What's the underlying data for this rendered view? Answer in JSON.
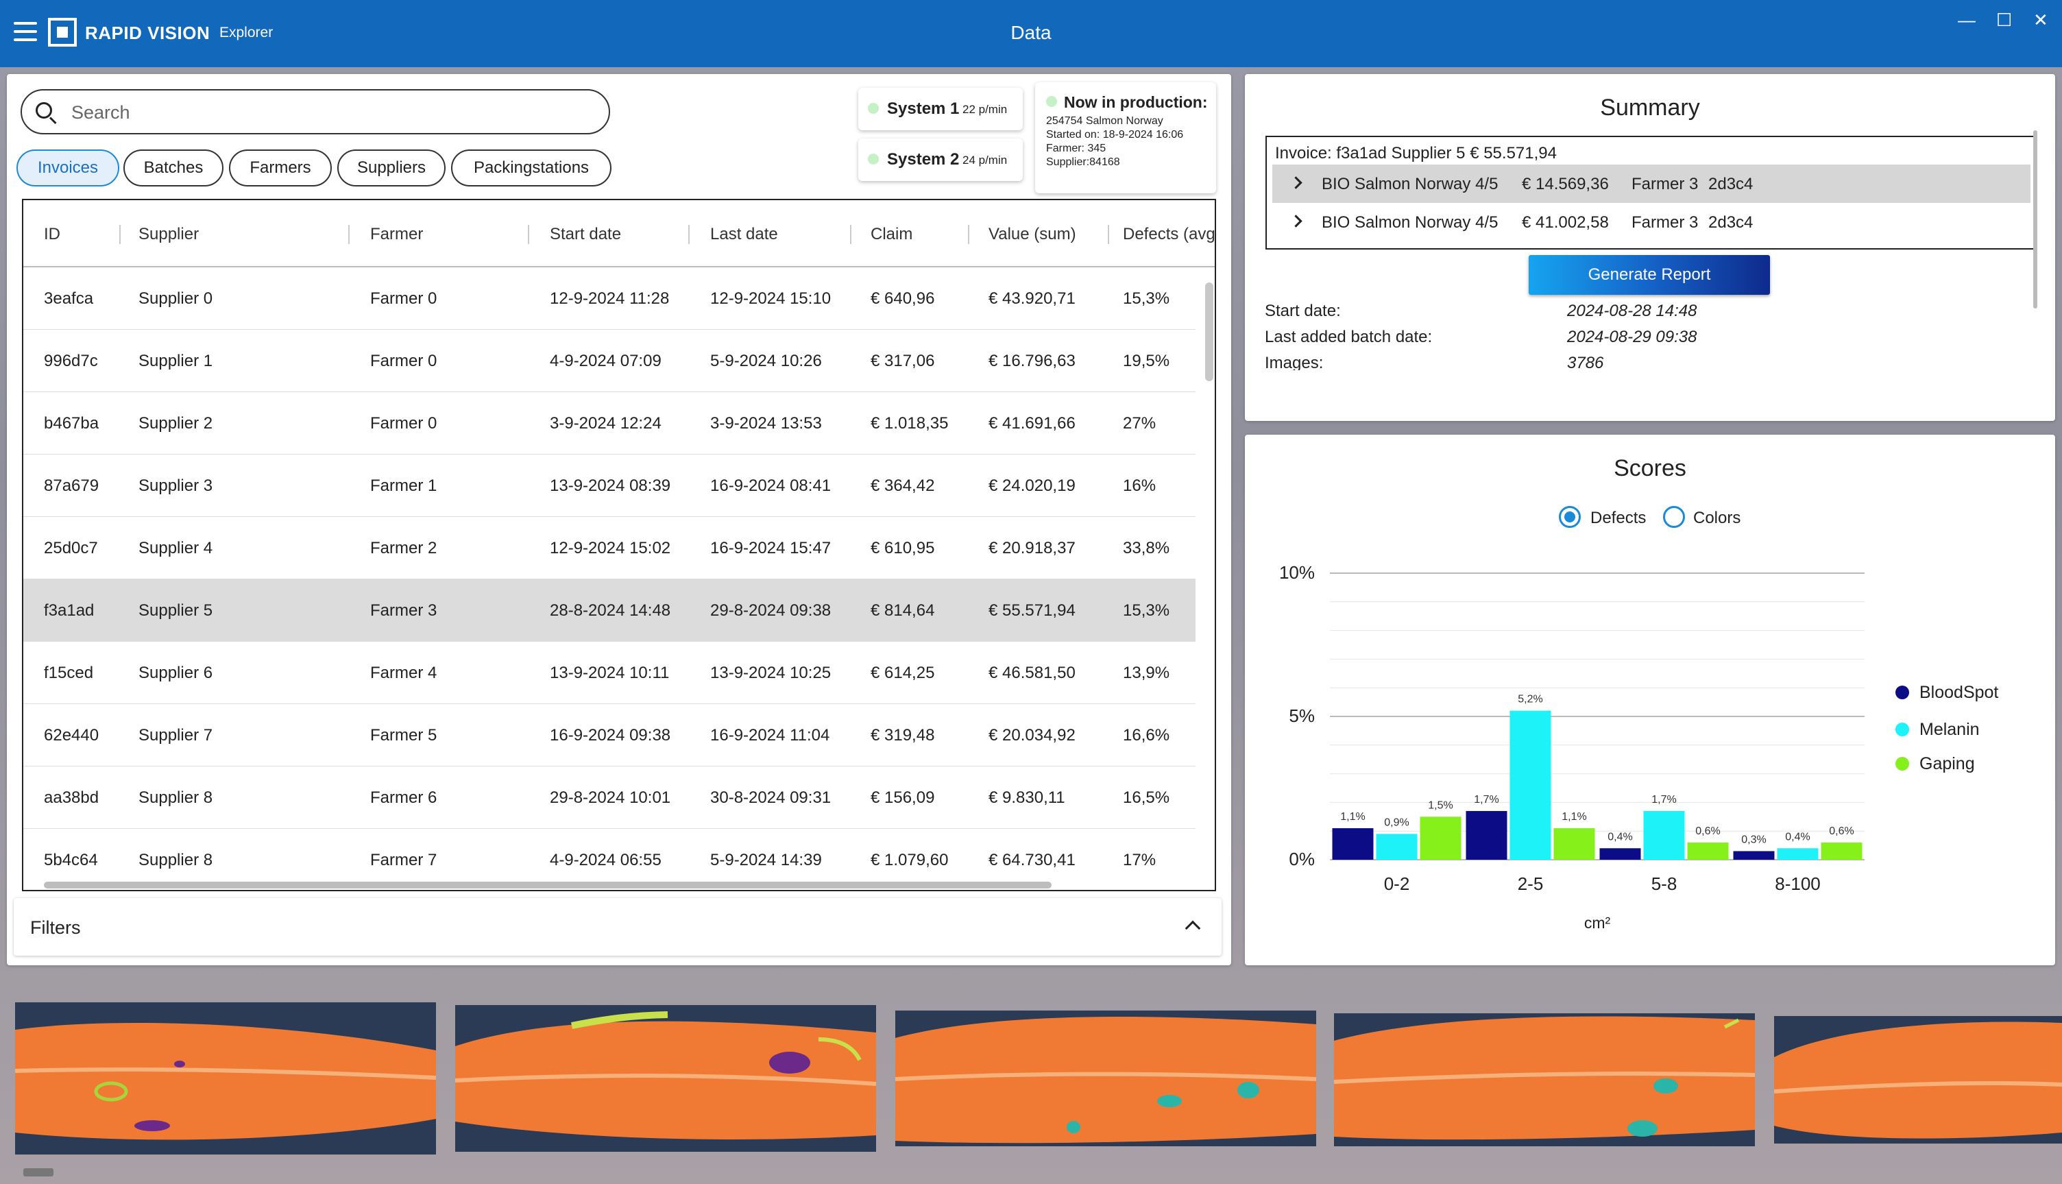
{
  "titlebar": {
    "brand": "RAPID VISION",
    "brand_sub": "Explorer",
    "window_title": "Data",
    "minimize": "—",
    "maximize": "☐",
    "close": "✕"
  },
  "search": {
    "placeholder": "Search"
  },
  "tabs": [
    {
      "label": "Invoices",
      "active": true
    },
    {
      "label": "Batches",
      "active": false
    },
    {
      "label": "Farmers",
      "active": false
    },
    {
      "label": "Suppliers",
      "active": false
    },
    {
      "label": "Packingstations",
      "active": false
    }
  ],
  "systems": [
    {
      "name": "System 1",
      "rate": "22 p/min",
      "status_color": "#c6f0c6"
    },
    {
      "name": "System 2",
      "rate": "24 p/min",
      "status_color": "#c6f0c6"
    }
  ],
  "production": {
    "title": "Now in production:",
    "lines": [
      "254754 Salmon Norway",
      "Started on: 18-9-2024 16:06",
      "Farmer: 345",
      "Supplier:84168"
    ]
  },
  "table": {
    "columns": [
      "ID",
      "Supplier",
      "Farmer",
      "Start date",
      "Last date",
      "Claim",
      "Value (sum)",
      "Defects (avg"
    ],
    "rows": [
      [
        "3eafca",
        "Supplier 0",
        "Farmer 0",
        "12-9-2024 11:28",
        "12-9-2024 15:10",
        "€ 640,96",
        "€ 43.920,71",
        "15,3%"
      ],
      [
        "996d7c",
        "Supplier 1",
        "Farmer 0",
        "4-9-2024 07:09",
        "5-9-2024 10:26",
        "€ 317,06",
        "€ 16.796,63",
        "19,5%"
      ],
      [
        "b467ba",
        "Supplier 2",
        "Farmer 0",
        "3-9-2024 12:24",
        "3-9-2024 13:53",
        "€ 1.018,35",
        "€ 41.691,66",
        "27%"
      ],
      [
        "87a679",
        "Supplier 3",
        "Farmer 1",
        "13-9-2024 08:39",
        "16-9-2024 08:41",
        "€ 364,42",
        "€ 24.020,19",
        "16%"
      ],
      [
        "25d0c7",
        "Supplier 4",
        "Farmer 2",
        "12-9-2024 15:02",
        "16-9-2024 15:47",
        "€ 610,95",
        "€ 20.918,37",
        "33,8%"
      ],
      [
        "f3a1ad",
        "Supplier 5",
        "Farmer 3",
        "28-8-2024 14:48",
        "29-8-2024 09:38",
        "€ 814,64",
        "€ 55.571,94",
        "15,3%"
      ],
      [
        "f15ced",
        "Supplier 6",
        "Farmer 4",
        "13-9-2024 10:11",
        "13-9-2024 10:25",
        "€ 614,25",
        "€ 46.581,50",
        "13,9%"
      ],
      [
        "62e440",
        "Supplier 7",
        "Farmer 5",
        "16-9-2024 09:38",
        "16-9-2024 11:04",
        "€ 319,48",
        "€ 20.034,92",
        "16,6%"
      ],
      [
        "aa38bd",
        "Supplier 8",
        "Farmer 6",
        "29-8-2024 10:01",
        "30-8-2024 09:31",
        "€ 156,09",
        "€ 9.830,11",
        "16,5%"
      ],
      [
        "5b4c64",
        "Supplier 8",
        "Farmer 7",
        "4-9-2024 06:55",
        "5-9-2024 14:39",
        "€ 1.079,60",
        "€ 64.730,41",
        "17%"
      ]
    ],
    "selected_row": 5
  },
  "filters": {
    "label": "Filters"
  },
  "summary": {
    "title": "Summary",
    "invoice_header": "Invoice: f3a1ad Supplier 5 € 55.571,94",
    "batches": [
      [
        "BIO Salmon Norway 4/5",
        "€ 14.569,36",
        "Farmer 3",
        "2d3c4"
      ],
      [
        "BIO Salmon Norway 4/5",
        "€ 41.002,58",
        "Farmer 3",
        "2d3c4"
      ]
    ],
    "generate_label": "Generate Report",
    "fields": [
      {
        "label": "Start date:",
        "value": "2024-08-28 14:48"
      },
      {
        "label": "Last added batch date:",
        "value": "2024-08-29 09:38"
      },
      {
        "label": "Images:",
        "value": "3786"
      }
    ]
  },
  "scores": {
    "title": "Scores",
    "radio": [
      {
        "label": "Defects",
        "selected": true
      },
      {
        "label": "Colors",
        "selected": false
      }
    ]
  },
  "chart_data": {
    "type": "bar",
    "categories": [
      "0-2",
      "2-5",
      "5-8",
      "8-100"
    ],
    "series": [
      {
        "name": "BloodSpot",
        "color": "#0c0c86",
        "values": [
          1.1,
          1.7,
          0.4,
          0.3
        ],
        "labels": [
          "1,1%",
          "1,7%",
          "0,4%",
          "0,3%"
        ]
      },
      {
        "name": "Melanin",
        "color": "#1df2f8",
        "values": [
          0.9,
          5.2,
          1.7,
          0.4
        ],
        "labels": [
          "0,9%",
          "5,2%",
          "1,7%",
          "0,4%"
        ]
      },
      {
        "name": "Gaping",
        "color": "#86f01a",
        "values": [
          1.5,
          1.1,
          0.6,
          0.6
        ],
        "labels": [
          "1,5%",
          "1,1%",
          "0,6%",
          "0,6%"
        ]
      }
    ],
    "ytick_labels": [
      "0%",
      "5%",
      "10%"
    ],
    "ylim": [
      0,
      10
    ],
    "xlabel": "cm²",
    "legend": "right",
    "grid": true
  }
}
